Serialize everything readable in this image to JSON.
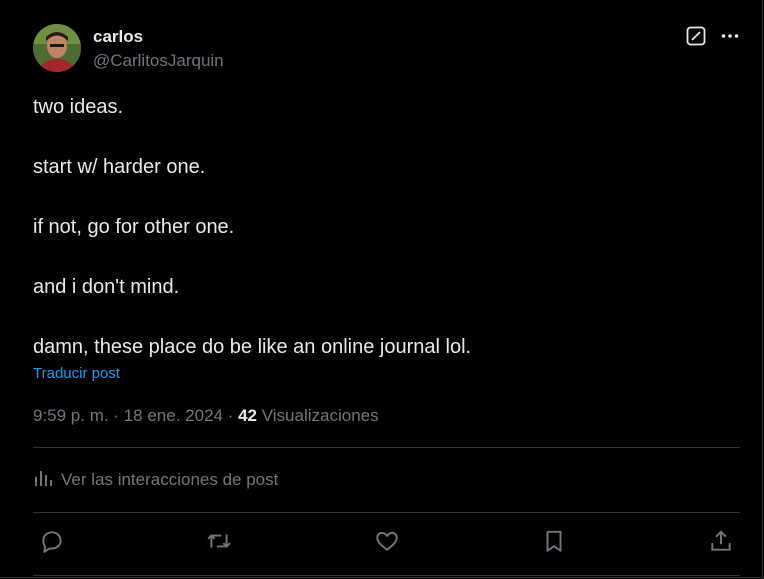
{
  "author": {
    "display_name": "carlos",
    "handle": "@CarlitosJarquin"
  },
  "tweet": {
    "paragraphs": [
      "two ideas.",
      "start w/ harder one.",
      "if not, go for other one.",
      "and i don't mind.",
      "damn, these place do be like an online journal lol."
    ],
    "translate_label": "Traducir post",
    "time": "9:59 p. m.",
    "separator": " · ",
    "date": "18 ene. 2024",
    "view_count": "42",
    "view_label": " Visualizaciones"
  },
  "interactions_label": "Ver las interacciones de post",
  "icons": {
    "grok": "grok-icon",
    "more": "more-icon",
    "analytics": "bar-chart-icon",
    "reply": "reply-icon",
    "retweet": "retweet-icon",
    "like": "heart-icon",
    "bookmark": "bookmark-icon",
    "share": "share-icon"
  },
  "colors": {
    "background": "#000000",
    "text": "#e7e9ea",
    "muted": "#71767b",
    "link": "#1d9bf0",
    "border": "#2f3336"
  }
}
